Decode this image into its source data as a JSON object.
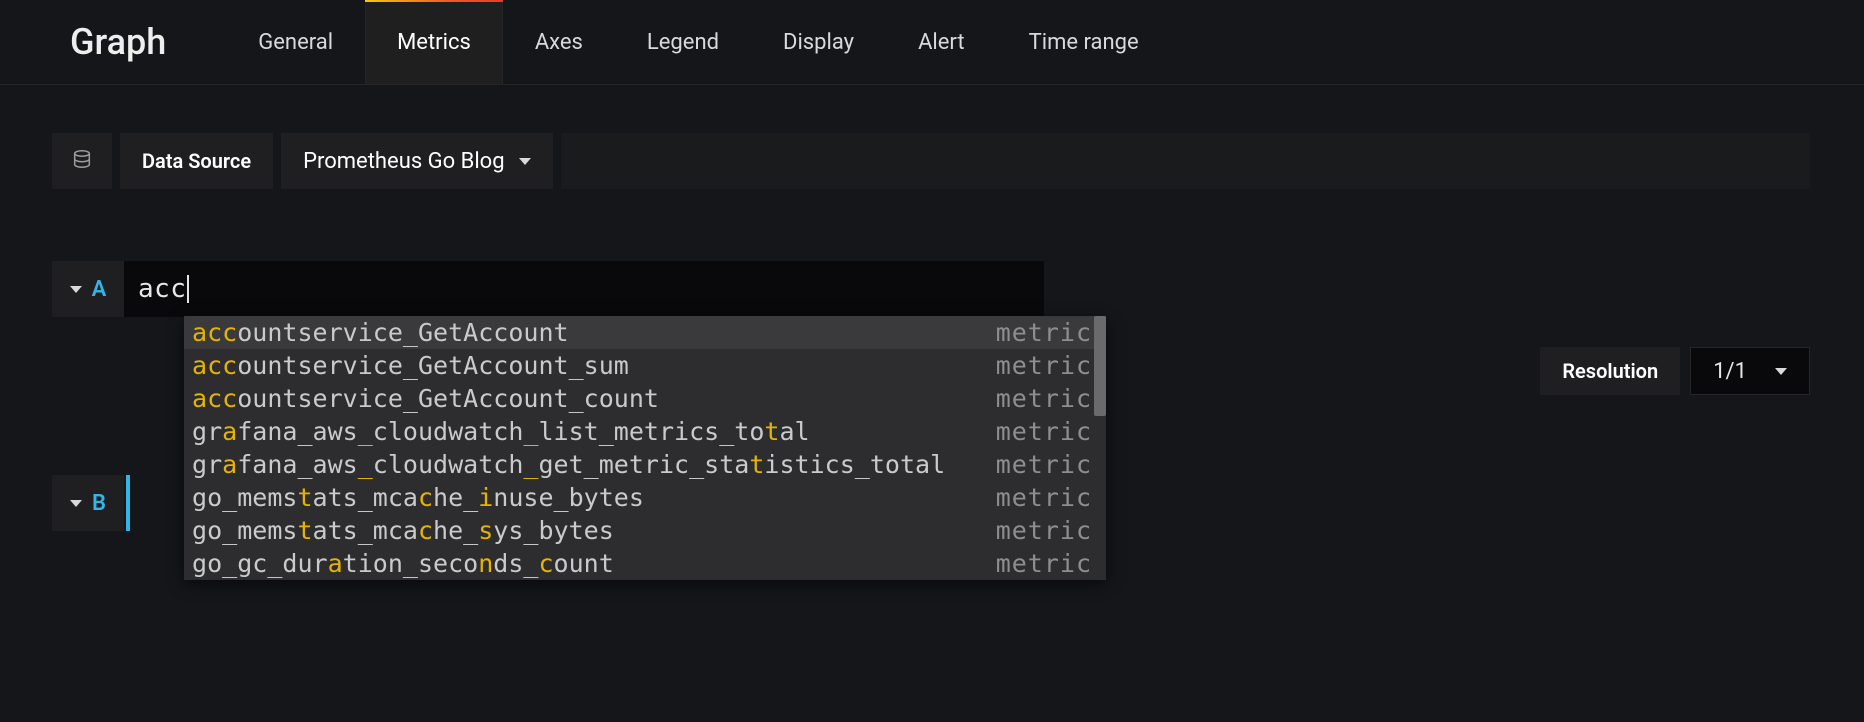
{
  "title": "Graph",
  "tabs": [
    "General",
    "Metrics",
    "Axes",
    "Legend",
    "Display",
    "Alert",
    "Time range"
  ],
  "active_tab": "Metrics",
  "datasource": {
    "label": "Data Source",
    "selected": "Prometheus Go Blog"
  },
  "queries": [
    {
      "letter": "A",
      "input": "acc",
      "suggestions": [
        {
          "plain": "accountservice_GetAccount",
          "highlights": [
            0,
            1,
            2
          ],
          "type": "metric",
          "selected": true
        },
        {
          "plain": "accountservice_GetAccount_sum",
          "highlights": [
            0,
            1,
            2
          ],
          "type": "metric",
          "selected": false
        },
        {
          "plain": "accountservice_GetAccount_count",
          "highlights": [
            0,
            1,
            2
          ],
          "type": "metric",
          "selected": false
        },
        {
          "plain": "grafana_aws_cloudwatch_list_metrics_total",
          "highlights": [
            2,
            11,
            22,
            38
          ],
          "type": "metric",
          "selected": false
        },
        {
          "plain": "grafana_aws_cloudwatch_get_metric_statistics_total",
          "highlights": [
            2,
            11,
            22,
            37
          ],
          "type": "metric",
          "selected": false
        },
        {
          "plain": "go_memstats_mcache_inuse_bytes",
          "highlights": [
            7,
            15,
            19
          ],
          "type": "metric",
          "selected": false
        },
        {
          "plain": "go_memstats_mcache_sys_bytes",
          "highlights": [
            7,
            15,
            19
          ],
          "type": "metric",
          "selected": false
        },
        {
          "plain": "go_gc_duration_seconds_count",
          "highlights": [
            9,
            19,
            23
          ],
          "type": "metric",
          "selected": false
        }
      ]
    },
    {
      "letter": "B",
      "input": ""
    }
  ],
  "resolution": {
    "label": "Resolution",
    "value": "1/1"
  }
}
